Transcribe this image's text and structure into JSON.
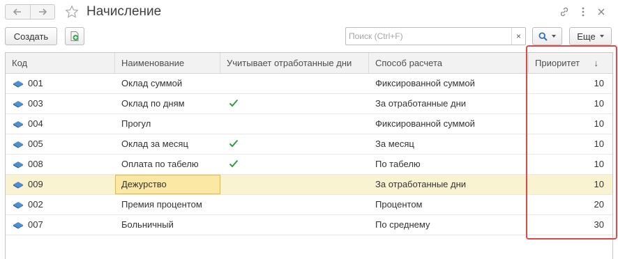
{
  "window": {
    "title": "Начисление",
    "icons": [
      "arrow-left-icon",
      "arrow-right-icon",
      "star-icon",
      "link-icon",
      "more-icon",
      "close-icon"
    ]
  },
  "toolbar": {
    "create_label": "Создать",
    "search_placeholder": "Поиск (Ctrl+F)",
    "search_value": "",
    "clear_label": "×",
    "more_label": "Еще"
  },
  "table": {
    "columns": [
      "Код",
      "Наименование",
      "Учитывает отработанные дни",
      "Способ расчета",
      "Приоритет"
    ],
    "sort_indicator": "↓",
    "rows": [
      {
        "code": "001",
        "name": "Оклад суммой",
        "counts_days": false,
        "method": "Фиксированной суммой",
        "priority": "10",
        "selected": false
      },
      {
        "code": "003",
        "name": "Оклад по дням",
        "counts_days": true,
        "method": "За отработанные дни",
        "priority": "10",
        "selected": false
      },
      {
        "code": "004",
        "name": "Прогул",
        "counts_days": false,
        "method": "Фиксированной суммой",
        "priority": "10",
        "selected": false
      },
      {
        "code": "005",
        "name": "Оклад за месяц",
        "counts_days": true,
        "method": "За месяц",
        "priority": "10",
        "selected": false
      },
      {
        "code": "008",
        "name": "Оплата по табелю",
        "counts_days": true,
        "method": "По табелю",
        "priority": "10",
        "selected": false
      },
      {
        "code": "009",
        "name": "Дежурство",
        "counts_days": false,
        "method": "За отработанные дни",
        "priority": "10",
        "selected": true
      },
      {
        "code": "002",
        "name": "Премия процентом",
        "counts_days": false,
        "method": "Процентом",
        "priority": "20",
        "selected": false
      },
      {
        "code": "007",
        "name": "Больничный",
        "counts_days": false,
        "method": "По среднему",
        "priority": "30",
        "selected": false
      }
    ]
  },
  "colors": {
    "selected_row": "#faf3d2",
    "focused_cell": "#fbe8a4",
    "checkmark": "#2e9e3e",
    "highlight_frame": "#e04848"
  }
}
